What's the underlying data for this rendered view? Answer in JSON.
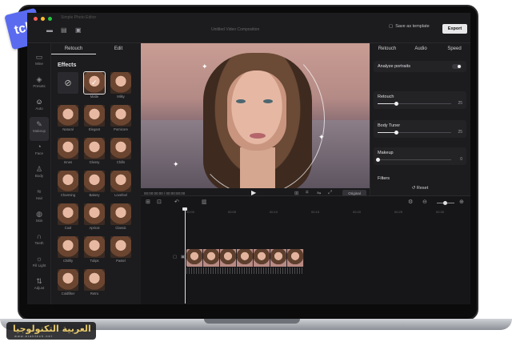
{
  "sticker": {
    "text": "tch"
  },
  "titlebar": {
    "app_name": "Simple Photo Editor",
    "doc_title": "Untitled Video Composition",
    "save_template_label": "Save as template",
    "export_label": "Export",
    "dot_colors": [
      "#ff5f57",
      "#febc2e",
      "#28c840"
    ]
  },
  "leftnav": {
    "items": [
      {
        "label": "Mine",
        "icon": "folder-icon",
        "glyph": "▭"
      },
      {
        "label": "Presets",
        "icon": "layers-icon",
        "glyph": "◈"
      },
      {
        "label": "Auto",
        "icon": "portrait-icon",
        "glyph": "☺"
      },
      {
        "label": "Makeup",
        "icon": "brush-icon",
        "glyph": "✎"
      },
      {
        "label": "Face",
        "icon": "face-icon",
        "glyph": "◔"
      },
      {
        "label": "Body",
        "icon": "body-icon",
        "glyph": "♙"
      },
      {
        "label": "Hair",
        "icon": "hair-icon",
        "glyph": "≈"
      },
      {
        "label": "Skin",
        "icon": "skin-icon",
        "glyph": "◍"
      },
      {
        "label": "Teeth",
        "icon": "teeth-icon",
        "glyph": "∩"
      },
      {
        "label": "Fill Light",
        "icon": "light-icon",
        "glyph": "☼"
      },
      {
        "label": "Adjust",
        "icon": "adjust-icon",
        "glyph": "⇅"
      }
    ]
  },
  "effects_panel": {
    "tabs": [
      "Retouch",
      "Edit"
    ],
    "title": "Effects",
    "items": [
      {
        "label": "",
        "kind": "none"
      },
      {
        "label": "Matte",
        "kind": "photo",
        "selected": true
      },
      {
        "label": "Milky",
        "kind": "photo"
      },
      {
        "label": "Natural",
        "kind": "photo"
      },
      {
        "label": "Elegant",
        "kind": "photo"
      },
      {
        "label": "Pornicore",
        "kind": "photo"
      },
      {
        "label": "Innes",
        "kind": "photo"
      },
      {
        "label": "Glossy",
        "kind": "photo"
      },
      {
        "label": "Chills",
        "kind": "photo"
      },
      {
        "label": "Charming",
        "kind": "photo"
      },
      {
        "label": "Bakery",
        "kind": "photo"
      },
      {
        "label": "Lovefeel",
        "kind": "photo"
      },
      {
        "label": "Cool",
        "kind": "photo"
      },
      {
        "label": "Apricot",
        "kind": "photo"
      },
      {
        "label": "Classic",
        "kind": "photo"
      },
      {
        "label": "Chilllly",
        "kind": "photo"
      },
      {
        "label": "Tulips",
        "kind": "photo"
      },
      {
        "label": "Pastel",
        "kind": "photo"
      },
      {
        "label": "Coldfilter",
        "kind": "photo"
      },
      {
        "label": "Retro",
        "kind": "photo"
      }
    ]
  },
  "preview": {
    "timecode": "00:00:00:00 / 00:00:00:00",
    "original_label": "Original"
  },
  "right_panel": {
    "tabs": [
      "Retouch",
      "Audio",
      "Speed"
    ],
    "analyze_label": "Analyze portraits",
    "analyze_on": true,
    "retouch": {
      "label": "Retouch",
      "value": 25,
      "display": "25"
    },
    "body_tuner": {
      "label": "Body Tuner",
      "value": 25,
      "display": "25"
    },
    "makeup": {
      "label": "Makeup",
      "value": 0,
      "display": "0"
    },
    "filters_label": "Filters",
    "reset_label": "Reset"
  },
  "timeline": {
    "ruler": [
      "00:00",
      "00:05",
      "00:10",
      "00:15",
      "00:20",
      "00:25",
      "00:30"
    ],
    "zoom_level": 0.35,
    "clip_frames": 7
  },
  "watermark": {
    "text": "العربية التكنولوجيا",
    "sub": "www.arabtech.net"
  }
}
